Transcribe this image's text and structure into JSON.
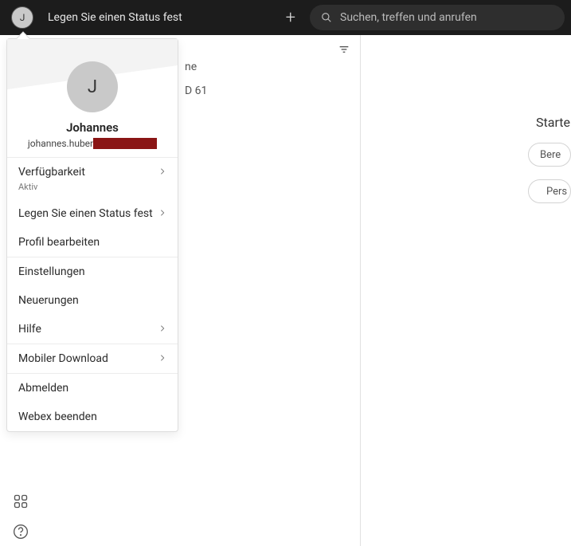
{
  "topbar": {
    "avatar_initial": "J",
    "status_text": "Legen Sie einen Status fest",
    "search_placeholder": "Suchen, treffen und anrufen"
  },
  "mid": {
    "partial1": "ne",
    "partial2": "D 61"
  },
  "rightpane": {
    "heading": "Starten S",
    "pill1": "Bere",
    "pill2": "Pers"
  },
  "menu": {
    "avatar_initial": "J",
    "username": "Johannes",
    "email_prefix": "johannes.huber",
    "items": {
      "availability": {
        "label": "Verfügbarkeit",
        "sub": "Aktiv"
      },
      "set_status": {
        "label": "Legen Sie einen Status fest"
      },
      "edit_profile": {
        "label": "Profil bearbeiten"
      },
      "settings": {
        "label": "Einstellungen"
      },
      "whatsnew": {
        "label": "Neuerungen"
      },
      "help": {
        "label": "Hilfe"
      },
      "mobile": {
        "label": "Mobiler Download"
      },
      "signout": {
        "label": "Abmelden"
      },
      "quit": {
        "label": "Webex beenden"
      }
    }
  }
}
